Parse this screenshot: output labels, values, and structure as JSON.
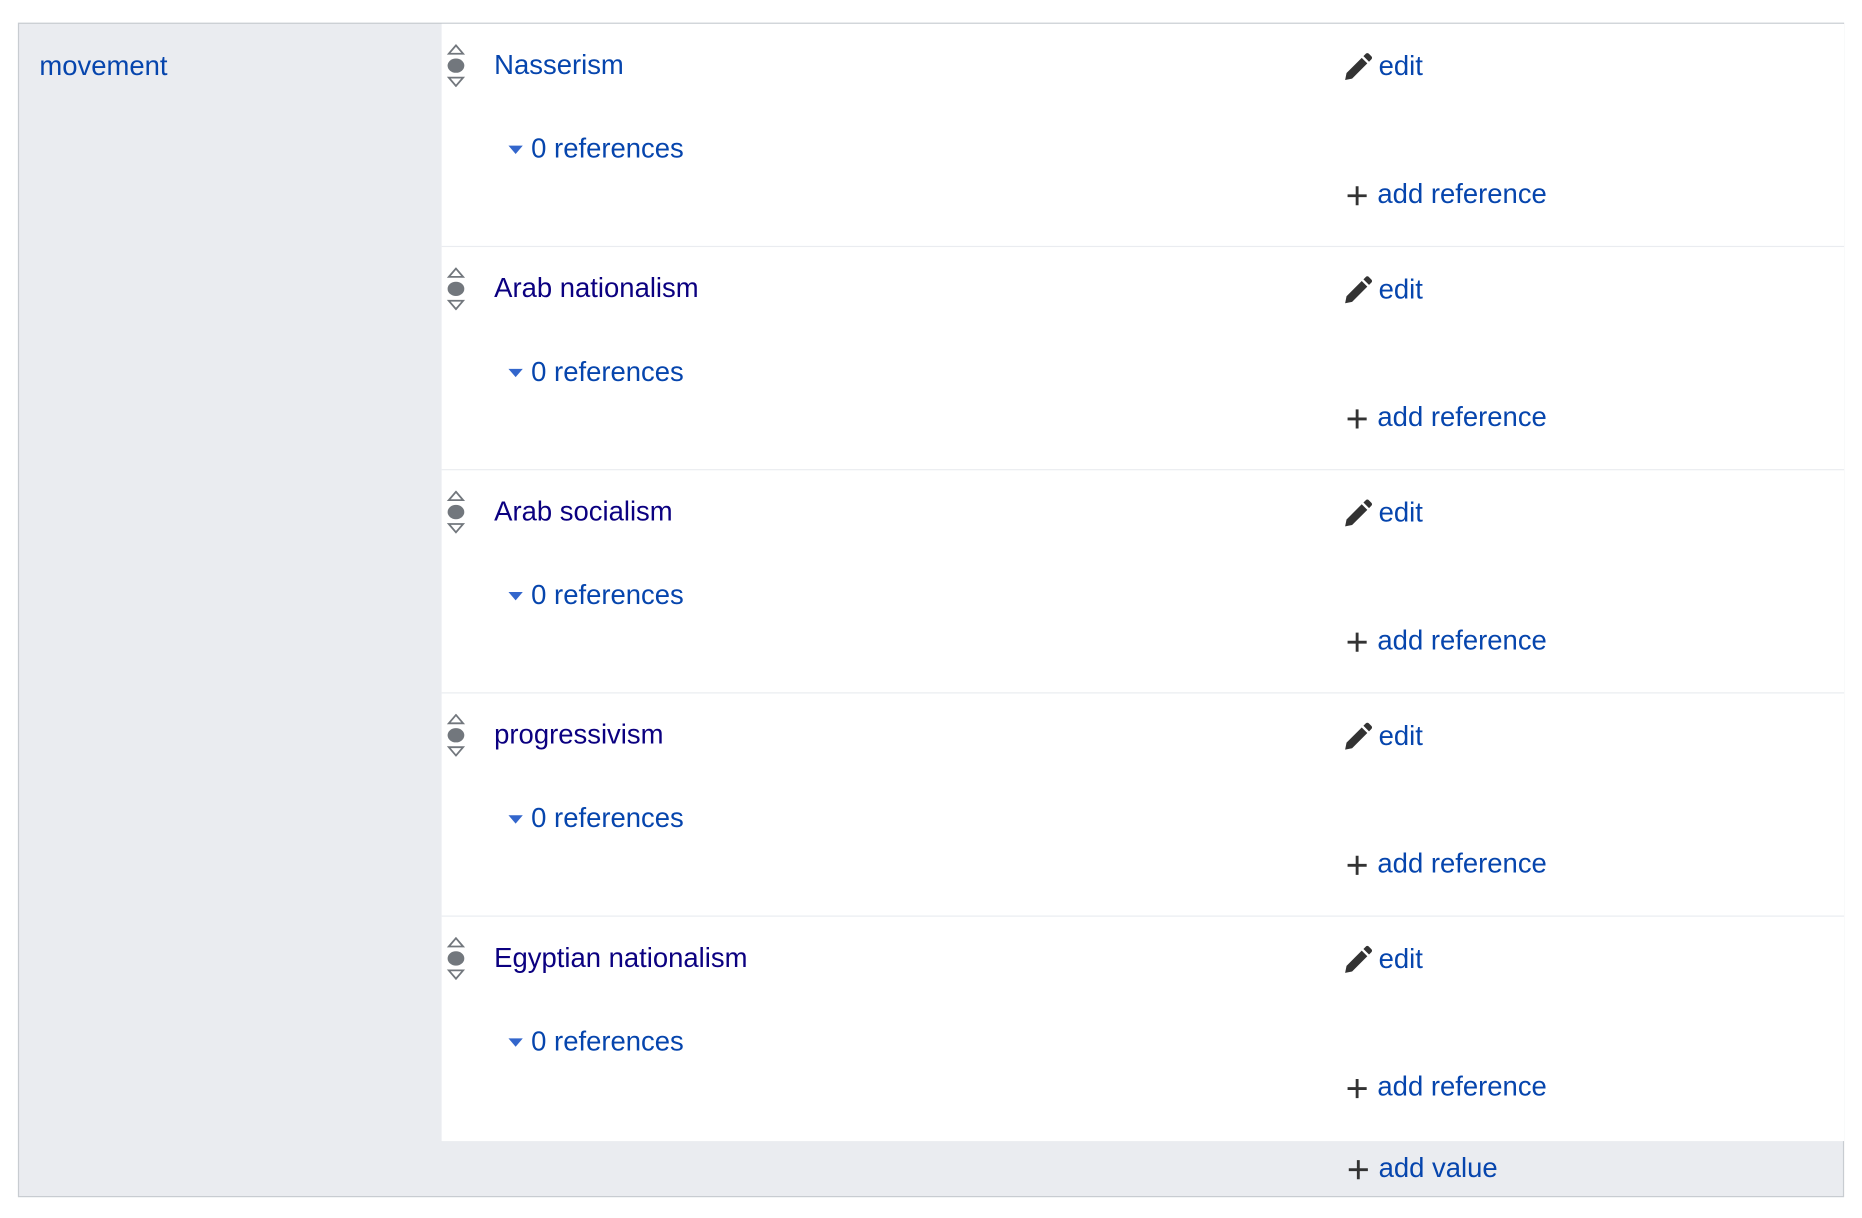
{
  "property": {
    "label": "movement"
  },
  "statements": [
    {
      "value": "Nasserism",
      "visited": false,
      "references": "0 references",
      "edit": "edit",
      "add_reference": "add reference"
    },
    {
      "value": "Arab nationalism",
      "visited": true,
      "references": "0 references",
      "edit": "edit",
      "add_reference": "add reference"
    },
    {
      "value": "Arab socialism",
      "visited": true,
      "references": "0 references",
      "edit": "edit",
      "add_reference": "add reference"
    },
    {
      "value": "progressivism",
      "visited": true,
      "references": "0 references",
      "edit": "edit",
      "add_reference": "add reference"
    },
    {
      "value": "Egyptian nationalism",
      "visited": true,
      "references": "0 references",
      "edit": "edit",
      "add_reference": "add reference"
    }
  ],
  "add_value": "add value",
  "colors": {
    "link": "#0645ad",
    "visited_link": "#0b0080",
    "panel_bg": "#eaecf0",
    "border": "#c8ccd1",
    "icon": "#333333"
  },
  "icons": {
    "rank": "rank-selector-icon",
    "edit": "pencil-icon",
    "add": "plus-icon",
    "toggle": "chevron-down-icon"
  }
}
